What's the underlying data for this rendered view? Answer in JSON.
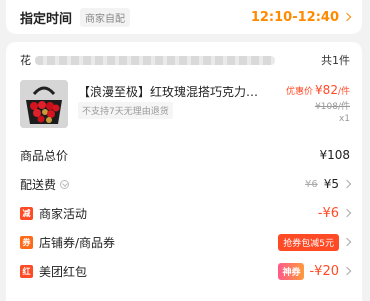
{
  "delivery": {
    "title": "指定时间",
    "tag": "商家自配",
    "time": "12:10-12:40"
  },
  "shop": {
    "prefix": "花",
    "count": "共1件"
  },
  "product": {
    "title": "【浪漫至极】红玫瑰混搭巧克力鲜…",
    "tag": "不支持7天无理由退货",
    "price_label": "优惠价",
    "price": "¥82",
    "price_unit": "/件",
    "original_price": "¥108/件",
    "qty": "x1"
  },
  "summary": {
    "total_label": "商品总价",
    "total_value": "¥108",
    "shipping_label": "配送费",
    "shipping_original": "¥6",
    "shipping_value": "¥5",
    "merchant_label": "商家活动",
    "merchant_badge": "减",
    "merchant_value": "-¥6",
    "coupon_label": "店铺券/商品券",
    "coupon_badge": "券",
    "coupon_promo": "抢券包减5元",
    "redpacket_label": "美团红包",
    "redpacket_badge": "红",
    "redpacket_pill": "神券",
    "redpacket_value": "-¥20"
  },
  "colors": {
    "accent_orange": "#ff8a00",
    "accent_red": "#ff4a26"
  }
}
